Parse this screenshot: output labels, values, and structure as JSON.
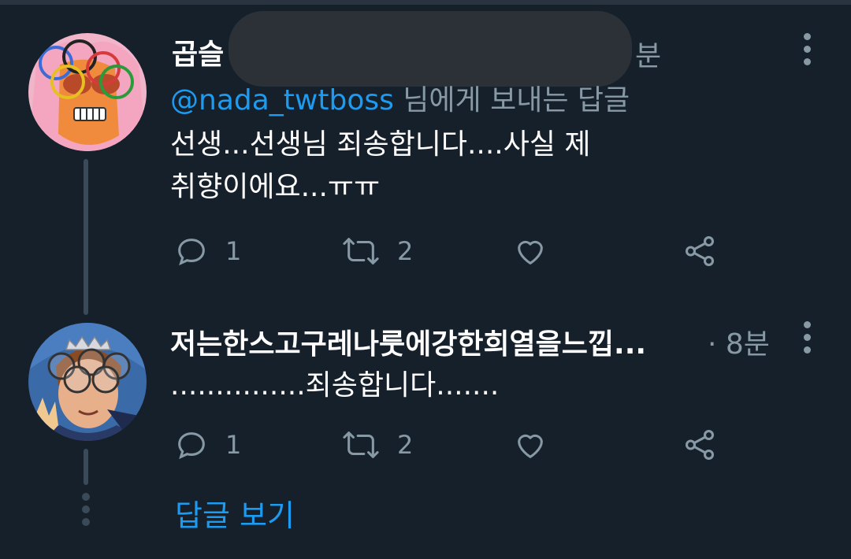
{
  "colors": {
    "background": "#15202b",
    "accent": "#1d9bf0",
    "muted": "#8899a6",
    "text": "#ffffff",
    "thread_line": "#3a4a59"
  },
  "tweet1": {
    "name": "곱슬",
    "time": "분",
    "reply_to_handle": "@nada_twtboss",
    "reply_to_suffix": " 님에게 보내는 답글",
    "text_line1": "선생...선생님 죄송합니다....사실 제",
    "text_line2": "취향이에요...ㅠㅠ",
    "reply_count": "1",
    "retweet_count": "2",
    "avatar_icon": "cartoon-face-with-glasses-avatar"
  },
  "tweet2": {
    "name": "저는한스고구레나룻에강한희열을느낍...",
    "time": "· 8분",
    "text": "...............죄송합니다.......",
    "reply_count": "1",
    "retweet_count": "2",
    "avatar_icon": "cartoon-prince-with-glasses-avatar"
  },
  "see_replies_label": "답글 보기",
  "icons": [
    "reply-icon",
    "retweet-icon",
    "like-icon",
    "share-icon",
    "more-icon"
  ]
}
